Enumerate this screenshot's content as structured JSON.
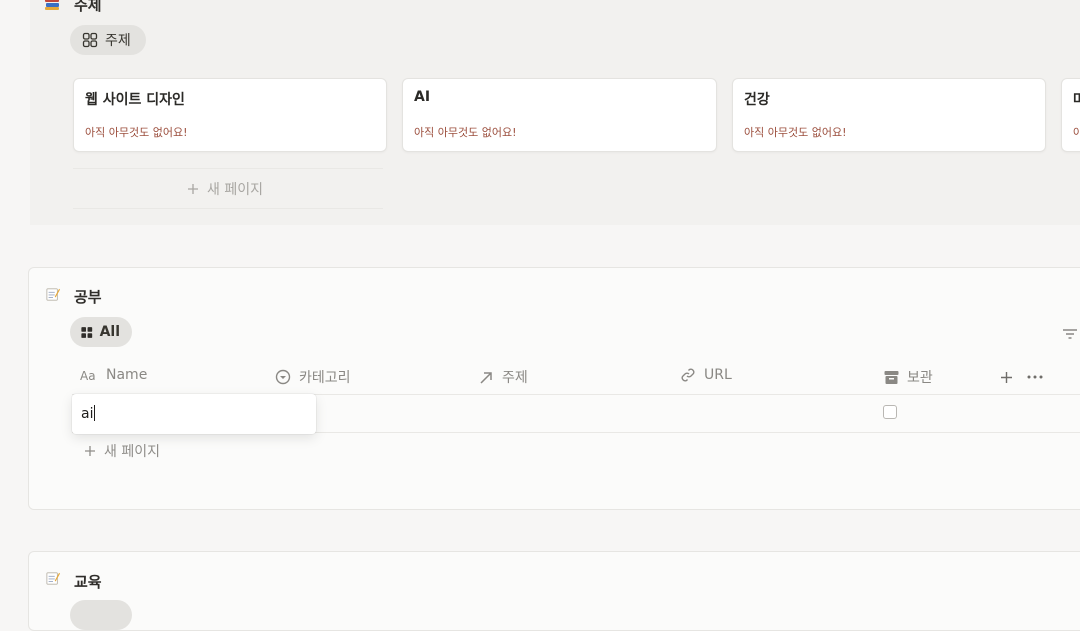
{
  "topic_section": {
    "title": "주제",
    "view_label": "주제",
    "cards": [
      {
        "title": "웹 사이트 디자인",
        "subtitle": "아직 아무것도 없어요!"
      },
      {
        "title": "AI",
        "subtitle": "아직 아무것도 없어요!"
      },
      {
        "title": "건강",
        "subtitle": "아직 아무것도 없어요!"
      },
      {
        "title": "마",
        "subtitle": "아"
      }
    ],
    "new_page_label": "새 페이지"
  },
  "study_db": {
    "title": "공부",
    "view_label": "All",
    "columns": [
      {
        "label": "Name",
        "icon": "text-type-icon"
      },
      {
        "label": "카테고리",
        "icon": "select-icon"
      },
      {
        "label": "주제",
        "icon": "relation-arrow-icon"
      },
      {
        "label": "URL",
        "icon": "link-icon"
      },
      {
        "label": "보관",
        "icon": "archive-icon"
      }
    ],
    "row": {
      "name_value": "ai"
    },
    "new_page_label": "새 페이지"
  },
  "education_db": {
    "title": "교육"
  },
  "colors": {
    "background": "#f7f6f5",
    "card_subtitle": "#9c4f3e",
    "pill": "#e3e2df"
  }
}
